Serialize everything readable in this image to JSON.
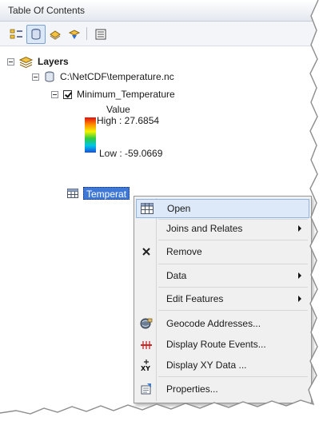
{
  "window": {
    "title": "Table Of Contents"
  },
  "toolbar": {
    "buttons": [
      {
        "icon": "list-by-drawing-order-icon"
      },
      {
        "icon": "list-by-source-icon",
        "active": true
      },
      {
        "icon": "list-by-visibility-icon"
      },
      {
        "icon": "list-by-selection-icon"
      },
      {
        "icon": "options-icon"
      }
    ]
  },
  "tree": {
    "root": {
      "label": "Layers"
    },
    "source": {
      "label": "C:\\NetCDF\\temperature.nc"
    },
    "layer": {
      "label": "Minimum_Temperature",
      "checked": true
    },
    "legend": {
      "title": "Value",
      "high": "High : 27.6854",
      "low": "Low : -59.0669"
    },
    "table": {
      "label": "Temperat"
    }
  },
  "context_menu": {
    "items": [
      {
        "label": "Open",
        "icon": "table-icon",
        "highlighted": true
      },
      {
        "label": "Joins and Relates",
        "submenu": true
      },
      {
        "label": "Remove",
        "icon": "remove-x-icon"
      },
      {
        "label": "Data",
        "submenu": true
      },
      {
        "label": "Edit Features",
        "submenu": true
      },
      {
        "label": "Geocode Addresses...",
        "icon": "geocode-globe-icon"
      },
      {
        "label": "Display Route Events...",
        "icon": "route-events-icon"
      },
      {
        "label": "Display XY Data ...",
        "icon": "xy-data-icon"
      },
      {
        "label": "Properties...",
        "icon": "properties-icon"
      }
    ]
  }
}
